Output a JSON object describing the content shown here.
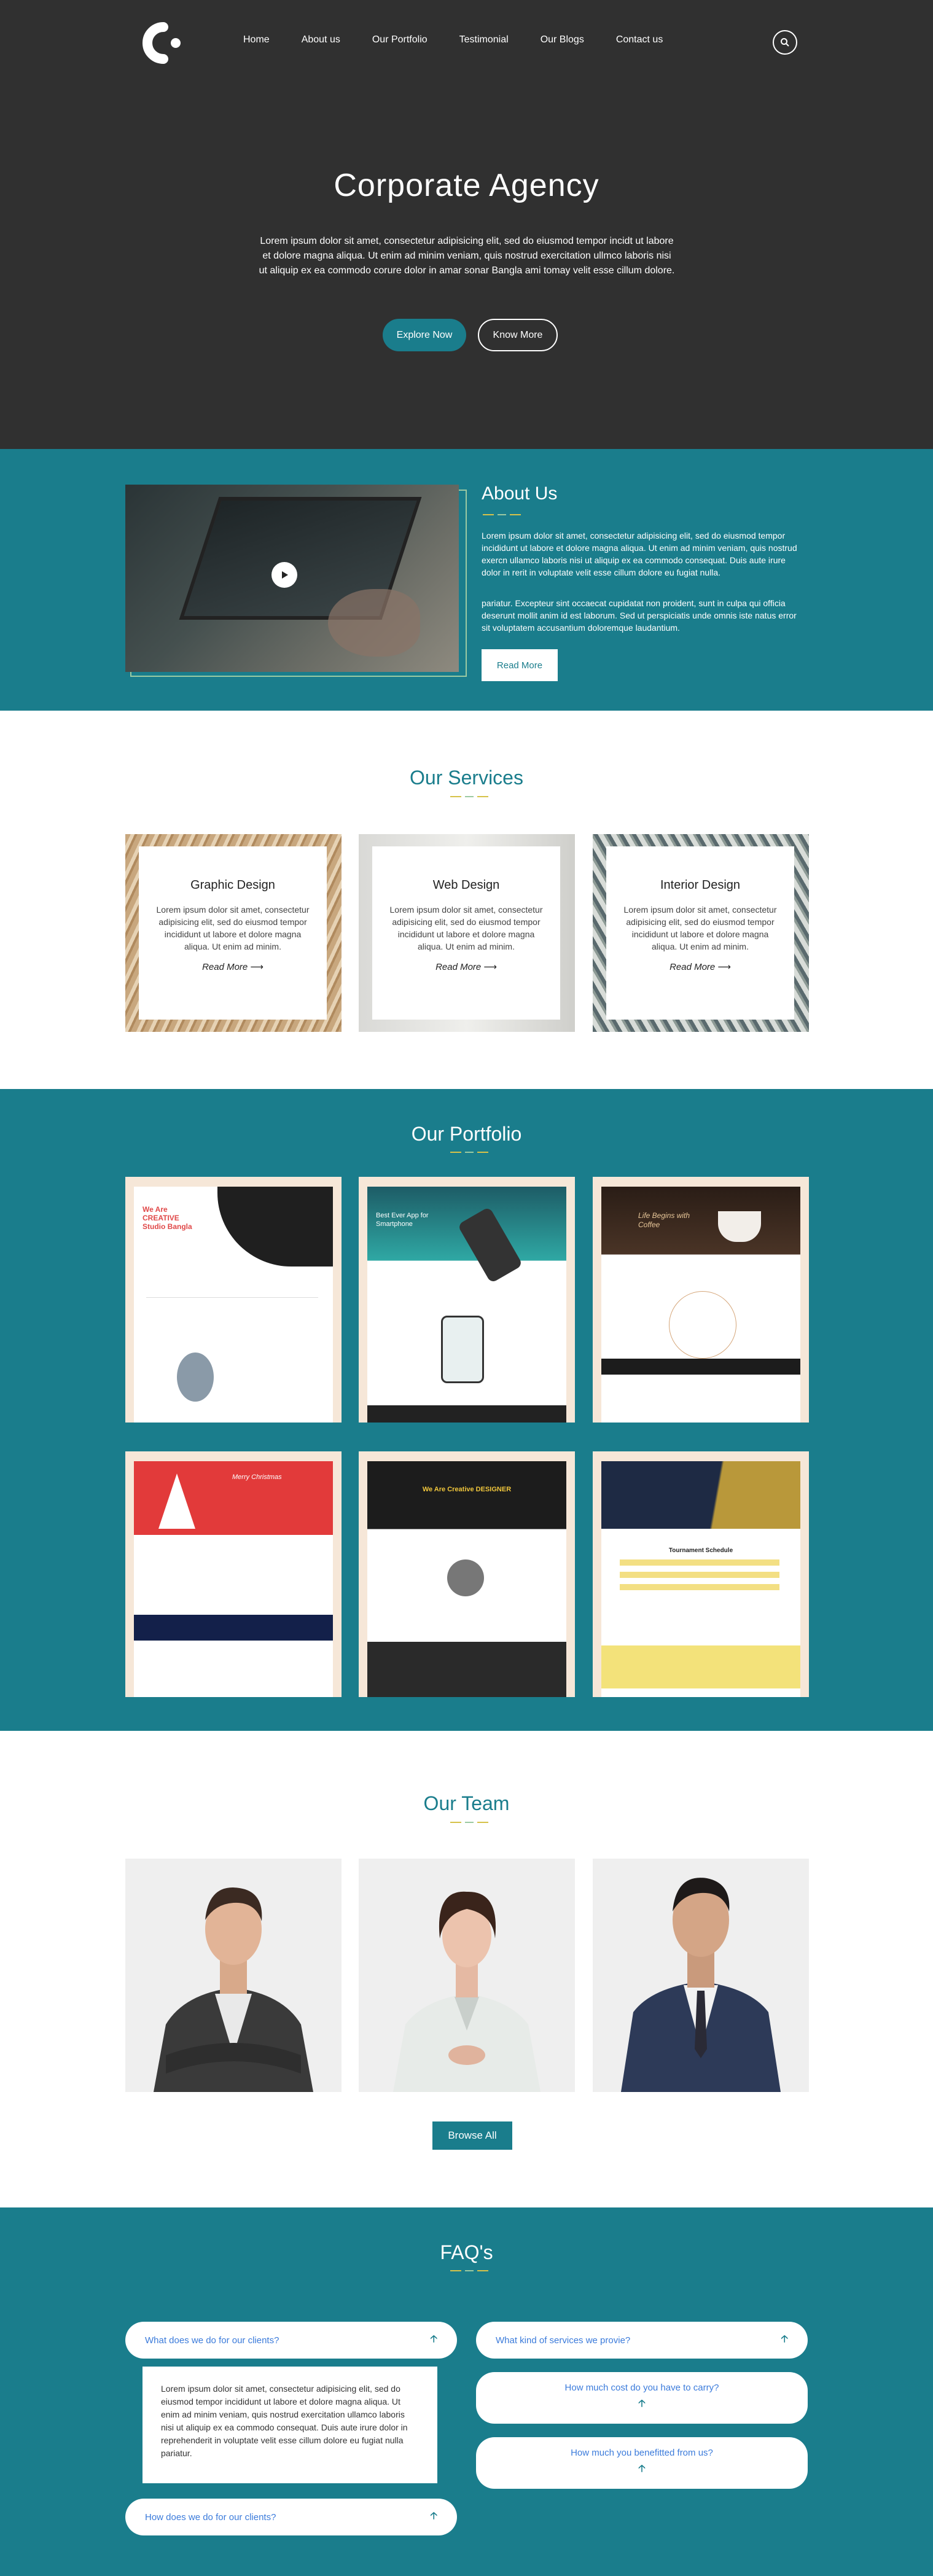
{
  "brand": {
    "logo_icon": "logo-c-icon"
  },
  "nav": {
    "items": [
      "Home",
      "About us",
      "Our Portfolio",
      "Testimonial",
      "Our Blogs",
      "Contact us"
    ]
  },
  "hero": {
    "title": "Corporate Agency",
    "text": "Lorem ipsum dolor sit amet, consectetur adipisicing elit, sed do eiusmod tempor incidt ut labore et dolore magna aliqua. Ut enim ad minim veniam, quis nostrud exercitation ullmco laboris nisi ut aliquip ex ea commodo corure dolor in amar sonar Bangla ami tomay velit esse cillum dolore.",
    "explore_label": "Explore Now",
    "know_label": "Know More"
  },
  "about": {
    "title": "About Us",
    "p1": "Lorem ipsum dolor sit amet, consectetur adipisicing elit, sed do eiusmod tempor incididunt ut labore et dolore magna aliqua. Ut enim ad minim veniam, quis nostrud exercn ullamco laboris nisi ut aliquip ex ea commodo consequat. Duis aute irure dolor in rerit in voluptate velit esse cillum dolore eu fugiat nulla.",
    "p2": "pariatur. Excepteur sint occaecat cupidatat non proident, sunt in culpa qui officia deserunt mollit anim id est laborum. Sed ut perspiciatis unde omnis iste natus error sit voluptatem accusantium doloremque laudantium.",
    "read_more_label": "Read More"
  },
  "services": {
    "title": "Our Services",
    "items": [
      {
        "title": "Graphic Design",
        "text": "Lorem ipsum dolor sit amet, consectetur adipisicing elit, sed do eiusmod tempor incididunt ut labore et dolore magna aliqua. Ut enim ad minim.",
        "link": "Read More"
      },
      {
        "title": "Web Design",
        "text": "Lorem ipsum dolor sit amet, consectetur adipisicing elit, sed do eiusmod tempor incididunt ut labore et dolore magna aliqua. Ut enim ad minim.",
        "link": "Read More"
      },
      {
        "title": "Interior Design",
        "text": "Lorem ipsum dolor sit amet, consectetur adipisicing elit, sed do eiusmod tempor incididunt ut labore et dolore magna aliqua. Ut enim ad minim.",
        "link": "Read More"
      }
    ]
  },
  "portfolio": {
    "title": "Our Portfolio",
    "items": [
      {
        "headline": "We Are CREATIVE Studio Bangla"
      },
      {
        "headline": "Best Ever App for Smartphone"
      },
      {
        "headline": "Life Begins with Coffee"
      },
      {
        "headline": "Merry Christmas"
      },
      {
        "headline": "We Are Creative DESIGNER"
      },
      {
        "headline": "Tournament Schedule"
      }
    ]
  },
  "team": {
    "title": "Our Team",
    "browse_label": "Browse All"
  },
  "faq": {
    "title": "FAQ's",
    "left": [
      {
        "q": "What does we do for our clients?"
      },
      {
        "q": "How does we do for our clients?"
      }
    ],
    "answer": "Lorem ipsum dolor sit amet, consectetur adipisicing elit, sed do eiusmod tempor incididunt ut labore et dolore magna aliqua. Ut enim ad minim veniam, quis nostrud exercitation ullamco laboris nisi ut aliquip ex ea commodo consequat. Duis aute irure dolor in reprehenderit in voluptate velit esse cillum dolore eu fugiat nulla pariatur.",
    "right": [
      {
        "q": "What kind of services we provie?"
      },
      {
        "q": "How much cost do you have to carry?"
      },
      {
        "q": "How much you benefitted from us?"
      }
    ]
  },
  "colors": {
    "teal": "#1a7d8c",
    "hero_bg": "#303030",
    "accent_yellow": "#d6c24a",
    "accent_green": "#9bc9a2",
    "link_blue": "#3b7bdb"
  }
}
